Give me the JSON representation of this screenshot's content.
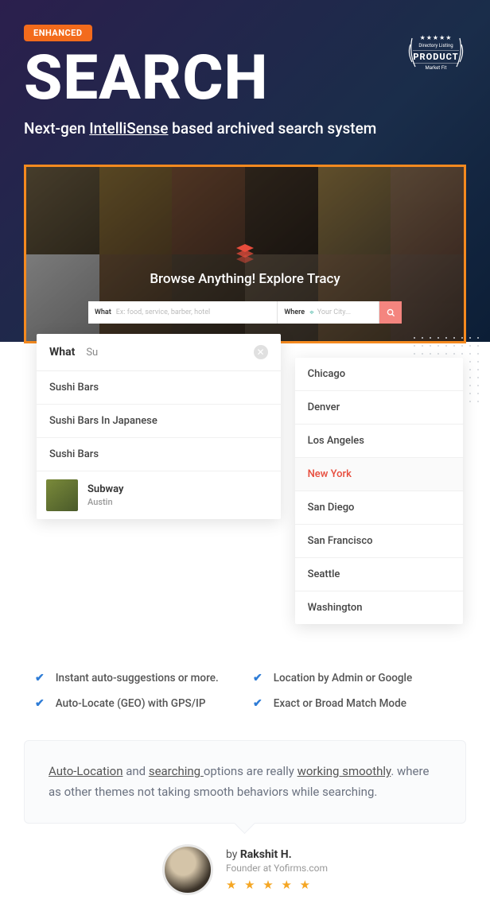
{
  "hero": {
    "badge": "ENHANCED",
    "title": "SEARCH",
    "subtitle_pre": "Next-gen ",
    "subtitle_u": "IntelliSense",
    "subtitle_post": " based archived search system"
  },
  "product_badge": {
    "stars": "★★★★★",
    "top": "Directory Listing",
    "mid": "PRODUCT",
    "bot": "Market Fit"
  },
  "screenshot": {
    "browse_title": "Browse Anything! Explore Tracy",
    "what_label": "What",
    "what_placeholder": "Ex: food, service, barber, hotel",
    "where_label": "Where",
    "where_placeholder": "Your City..."
  },
  "what_dropdown": {
    "label": "What",
    "input": "Su",
    "items": [
      {
        "label": "Sushi Bars"
      },
      {
        "label": "Sushi Bars In Japanese"
      },
      {
        "label": "Sushi Bars"
      }
    ],
    "rich": {
      "title": "Subway",
      "sub": "Austin"
    }
  },
  "where_dropdown": {
    "items": [
      "Chicago",
      "Denver",
      "Los Angeles",
      "New York",
      "San Diego",
      "San Francisco",
      "Seattle",
      "Washington"
    ],
    "selected": "New York"
  },
  "features": [
    "Instant auto-suggestions or more.",
    "Location by Admin or Google",
    "Auto-Locate (GEO) with GPS/IP",
    "Exact or Broad Match Mode"
  ],
  "testimonial": {
    "u1": "Auto-Location",
    "p1": " and ",
    "u2": "searching ",
    "p2": "options are really ",
    "u3": "working smoothly",
    "p3": ". where as other themes not taking smooth behaviors while searching."
  },
  "author": {
    "by_pre": "by ",
    "name": "Rakshit H.",
    "role": "Founder at Yofirms.com",
    "stars": "★ ★ ★ ★ ★"
  }
}
